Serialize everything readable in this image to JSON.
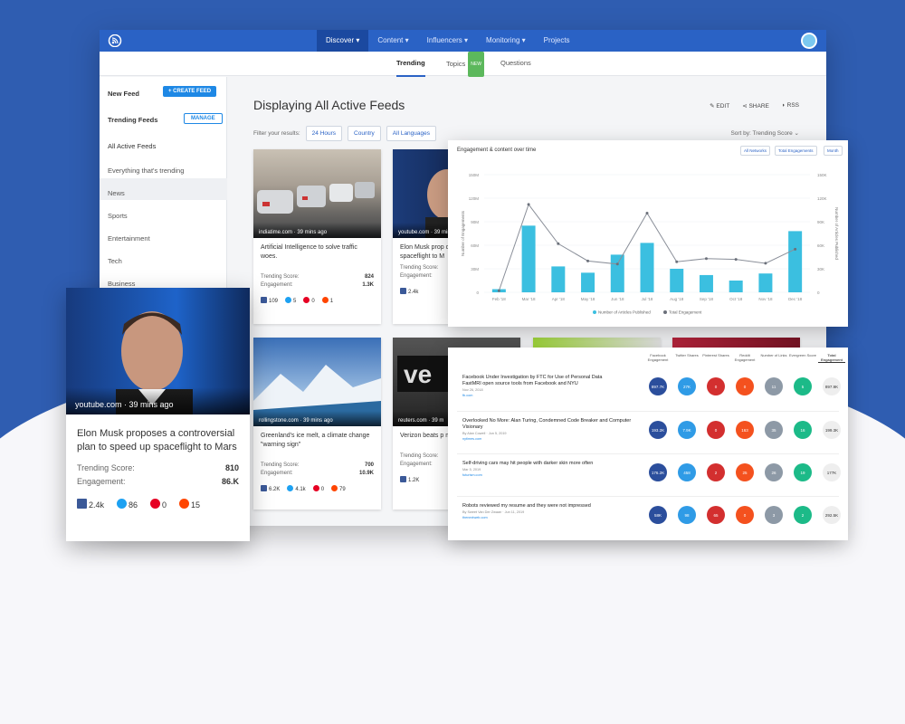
{
  "colors": {
    "brand": "#2a62c5",
    "accent": "#1e88e5",
    "bar": "#3bbfe0",
    "line": "#8a8f99"
  },
  "nav": {
    "items": [
      {
        "label": "Discover",
        "icon": "chevron-down-icon"
      },
      {
        "label": "Content",
        "icon": "chevron-down-icon"
      },
      {
        "label": "Influencers",
        "icon": "chevron-down-icon"
      },
      {
        "label": "Monitoring",
        "icon": "chevron-down-icon"
      },
      {
        "label": "Projects"
      }
    ]
  },
  "subnav": {
    "tabs": [
      {
        "label": "Trending"
      },
      {
        "label": "Topics",
        "badge": "NEW"
      },
      {
        "label": "Questions"
      }
    ]
  },
  "sidebar": {
    "new_feed": "New Feed",
    "create_feed": "+ CREATE FEED",
    "trending_feeds": "Trending Feeds",
    "manage": "MANAGE",
    "items": [
      "All Active Feeds",
      "Everything that's trending",
      "News",
      "Sports",
      "Entertainment",
      "Tech",
      "Business"
    ]
  },
  "main": {
    "title": "Displaying All Active Feeds",
    "actions": [
      "EDIT",
      "SHARE",
      "RSS"
    ],
    "filter_label": "Filter your results:",
    "filters": [
      "24 Hours",
      "Country",
      "All Languages"
    ],
    "sort": "Sort by: Trending Score"
  },
  "cards": [
    {
      "source": "indiatime.com · 39 mins ago",
      "title": "Artificial Intelligence to solve traffic woes.",
      "score_label": "Trending Score:",
      "score": "824",
      "eng_label": "Engagement:",
      "engagement": "1.3K",
      "fb": "109",
      "tw": "5",
      "pi": "0",
      "rd": "1"
    },
    {
      "source": "youtube.com · 39 mins ago",
      "title": "Elon Musk prop controversial pl spaceflight to M",
      "score_label": "Trending Score:",
      "score": "",
      "eng_label": "Engagement:",
      "engagement": "",
      "fb": "2.4k",
      "tw": "",
      "pi": "",
      "rd": ""
    },
    {
      "source": "rollingstone.com · 39 mins ago",
      "title": "Greenland's ice melt, a climate change \"warning sign\"",
      "score_label": "Trending Score:",
      "score": "700",
      "eng_label": "Engagement:",
      "engagement": "10.9K",
      "fb": "6.2K",
      "tw": "4.1k",
      "pi": "0",
      "rd": "79"
    },
    {
      "source": "reuters.com · 39 m",
      "title": "Verizon beats p monthly phone",
      "score_label": "Trending Score:",
      "score": "",
      "eng_label": "Engagement:",
      "engagement": "",
      "fb": "1.2K",
      "tw": "",
      "pi": "",
      "rd": ""
    }
  ],
  "big_card": {
    "source": "youtube.com · 39 mins ago",
    "title": "Elon Musk proposes a controversial plan to speed up spaceflight to Mars",
    "score_label": "Trending Score:",
    "score": "810",
    "eng_label": "Engagement:",
    "engagement": "86.K",
    "fb": "2.4k",
    "tw": "86",
    "pi": "0",
    "rd": "15"
  },
  "chart_window": {
    "title": "Engagement & content over time",
    "pills": [
      "All Networks",
      "Total Engagements",
      "Month"
    ]
  },
  "chart_data": {
    "type": "bar",
    "categories": [
      "Feb '18",
      "Mar '18",
      "Apr '18",
      "May '18",
      "Jun '18",
      "Jul '18",
      "Aug '18",
      "Sep '18",
      "Oct '18",
      "Nov '18",
      "Dec '18"
    ],
    "series": [
      {
        "name": "Number of Articles Published",
        "type": "bar",
        "values": [
          4,
          85,
          33,
          25,
          48,
          63,
          30,
          22,
          15,
          24,
          78
        ]
      },
      {
        "name": "Total Engagement",
        "type": "line",
        "values": [
          2,
          112,
          62,
          40,
          36,
          101,
          39,
          43,
          42,
          37,
          55
        ]
      }
    ],
    "ylabel": "Number of Engagements",
    "y2label": "Number of Articles Published",
    "yticks": [
      "150M",
      "120M",
      "90M",
      "60M",
      "30M",
      "0"
    ],
    "y2ticks": [
      "150K",
      "120K",
      "90K",
      "60K",
      "30K",
      "0"
    ],
    "ylim": [
      0,
      150
    ],
    "grid": true,
    "legend": "bottom"
  },
  "table_window": {
    "headers": [
      "Facebook Engagement",
      "Twitter Shares",
      "Pinterest Shares",
      "Reddit Engagement",
      "Number of Links",
      "Evergreen Score",
      "Total Engagement"
    ],
    "rows": [
      {
        "title": "Facebook Under Investigation by FTC for Use of Personal Data",
        "subtitle": "FastMRI open source tools from Facebook and NYU",
        "meta": "Nov 26, 2018",
        "link": "fb.com",
        "values": [
          "897.7K",
          "27K",
          "0",
          "0",
          "11",
          "5",
          "897.9K"
        ]
      },
      {
        "title": "Overlooked No More: Alan Turing, Condemned Code Breaker and Computer Visionary",
        "subtitle": "",
        "meta": "By Alan Cowell · Jun 5, 2019",
        "link": "nytimes.com",
        "values": [
          "193.2K",
          "7.9K",
          "0",
          "163",
          "35",
          "16",
          "199.3K"
        ]
      },
      {
        "title": "Self-driving cars may hit people with darker skin more often",
        "subtitle": "",
        "meta": "Mar 5, 2019",
        "link": "futurism.com",
        "values": [
          "176.2K",
          "458",
          "2",
          "25",
          "26",
          "19",
          "177K"
        ]
      },
      {
        "title": "Robots reviewed my resume and they were not impressed",
        "subtitle": "",
        "meta": "By Sweet Van Der Zwaan · Jun 11, 2019",
        "link": "thenextweb.com",
        "values": [
          "58K",
          "98",
          "65",
          "0",
          "3",
          "2",
          "292.5K"
        ]
      }
    ]
  }
}
